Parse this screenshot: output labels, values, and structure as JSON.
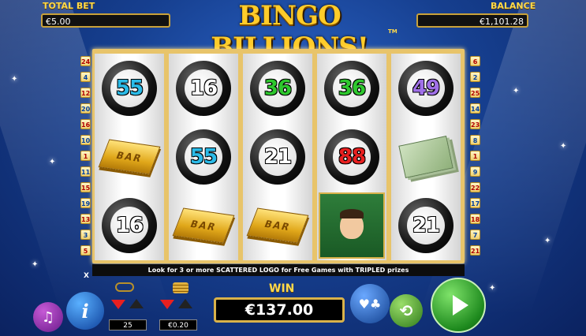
{
  "header": {
    "total_bet_label": "TOTAL BET",
    "total_bet_value": "€5.00",
    "balance_label": "BALANCE",
    "balance_value": "€1,101.28",
    "title": "BINGO BILLIONS!",
    "tm": "TM"
  },
  "paylines_left": [
    "24",
    "4",
    "12",
    "20",
    "16",
    "10",
    "1",
    "11",
    "15",
    "19",
    "13",
    "3",
    "5"
  ],
  "paylines_right": [
    "6",
    "2",
    "25",
    "14",
    "23",
    "8",
    "1",
    "9",
    "22",
    "17",
    "18",
    "7",
    "21"
  ],
  "reels": [
    [
      {
        "type": "ball",
        "number": "55",
        "color": "#2bbbe8"
      },
      {
        "type": "bar",
        "label": "BAR"
      },
      {
        "type": "ball",
        "number": "16",
        "color": "#ffffff"
      }
    ],
    [
      {
        "type": "ball",
        "number": "16",
        "color": "#ffffff"
      },
      {
        "type": "ball",
        "number": "55",
        "color": "#2bbbe8"
      },
      {
        "type": "bar",
        "label": "BAR"
      }
    ],
    [
      {
        "type": "ball",
        "number": "36",
        "color": "#2ec82e"
      },
      {
        "type": "ball",
        "number": "21",
        "color": "#ffffff"
      },
      {
        "type": "bar",
        "label": "BAR"
      }
    ],
    [
      {
        "type": "ball",
        "number": "36",
        "color": "#2ec82e"
      },
      {
        "type": "ball",
        "number": "88",
        "color": "#e82020"
      },
      {
        "type": "host",
        "label": ""
      }
    ],
    [
      {
        "type": "ball",
        "number": "49",
        "color": "#a070e8"
      },
      {
        "type": "money",
        "label": ""
      },
      {
        "type": "ball",
        "number": "21",
        "color": "#ffffff"
      }
    ]
  ],
  "message": "Look for 3 or more SCATTERED LOGO for Free Games with TRIPLED prizes",
  "controls": {
    "lines_value": "25",
    "coin_value": "€0.20",
    "win_label": "WIN",
    "win_value": "€137.00",
    "x_label": "X"
  },
  "colors": {
    "accent_gold": "#d9b24a",
    "spin_green": "#2fae3a"
  }
}
